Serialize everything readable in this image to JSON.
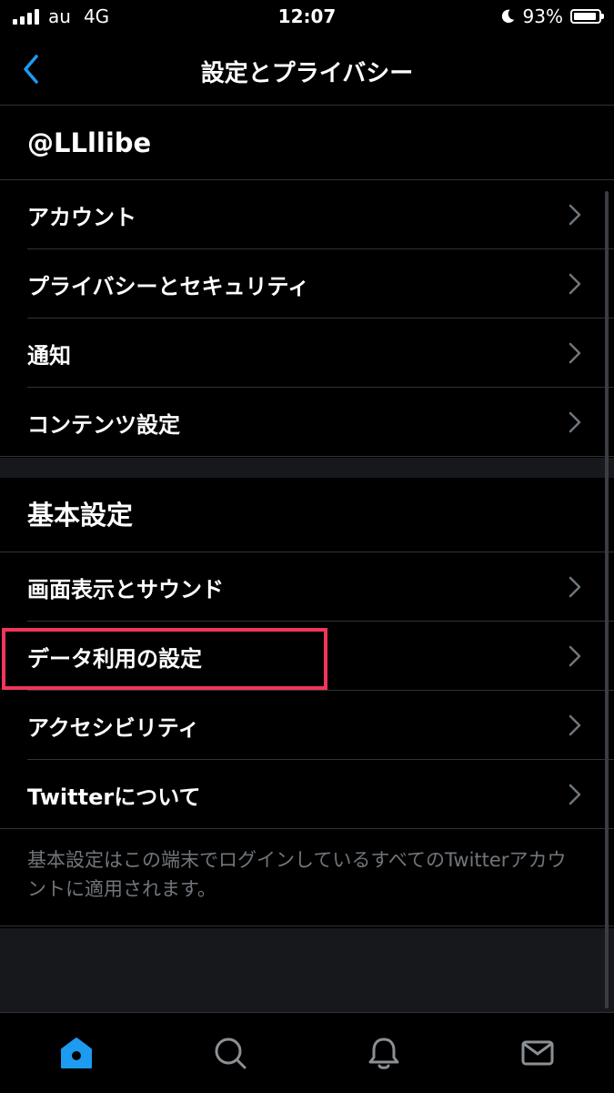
{
  "status_bar": {
    "carrier": "au",
    "network": "4G",
    "time": "12:07",
    "battery": "93%",
    "battery_level": 0.93,
    "icons": [
      "signal-bars-icon",
      "moon-icon",
      "battery-icon"
    ]
  },
  "nav": {
    "back_icon": "chevron-left-icon",
    "title": "設定とプライバシー"
  },
  "account_section": {
    "username": "@LLllibe",
    "items": [
      {
        "label": "アカウント"
      },
      {
        "label": "プライバシーとセキュリティ"
      },
      {
        "label": "通知"
      },
      {
        "label": "コンテンツ設定"
      }
    ]
  },
  "general_section": {
    "title": "基本設定",
    "items": [
      {
        "label": "画面表示とサウンド"
      },
      {
        "label": "データ利用の設定"
      },
      {
        "label": "アクセシビリティ"
      },
      {
        "label": "Twitterについて"
      }
    ],
    "note": "基本設定はこの端末でログインしているすべてのTwitterアカウントに適用されます。"
  },
  "tab_bar": {
    "tabs": [
      "home-icon",
      "search-icon",
      "notifications-icon",
      "messages-icon"
    ],
    "active": "home-icon"
  },
  "colors": {
    "accent": "#1d9bf0",
    "highlight": "#f0365a",
    "background": "#000000",
    "muted_text": "#71767b"
  }
}
